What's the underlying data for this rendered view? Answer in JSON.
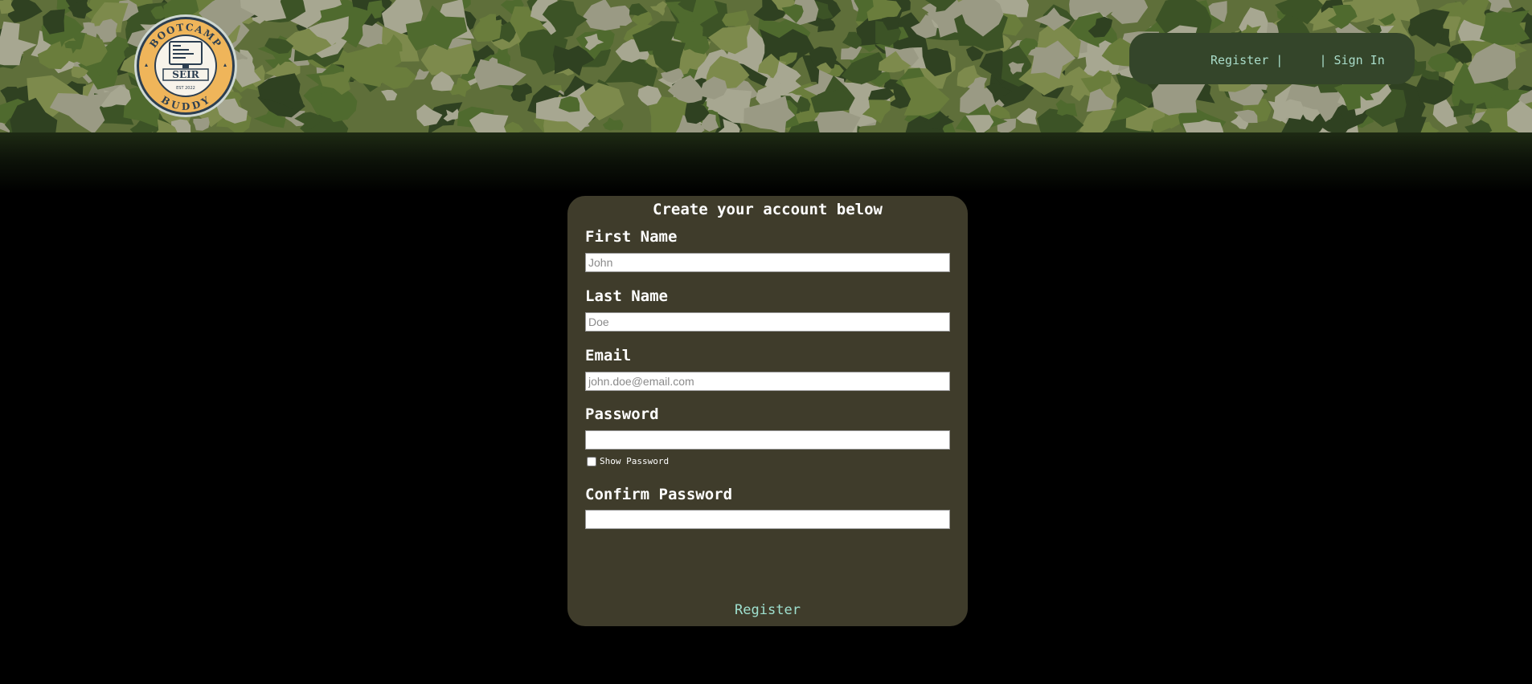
{
  "header": {
    "logo": {
      "top_text": "BOOTCAMP",
      "center_text": "SEIR",
      "est_text": "EST 2022",
      "bottom_text": "BUDDY"
    },
    "nav": {
      "register_label": "Register",
      "separator": "|",
      "sign_in_label": "Sign In"
    }
  },
  "form": {
    "title": "Create your account below",
    "first_name": {
      "label": "First Name",
      "placeholder": "John",
      "value": ""
    },
    "last_name": {
      "label": "Last Name",
      "placeholder": "Doe",
      "value": ""
    },
    "email": {
      "label": "Email",
      "placeholder": "john.doe@email.com",
      "value": ""
    },
    "password": {
      "label": "Password",
      "placeholder": "",
      "value": ""
    },
    "show_password_label": "Show Password",
    "show_password_checked": false,
    "confirm_password": {
      "label": "Confirm Password",
      "placeholder": "",
      "value": ""
    },
    "submit_label": "Register"
  },
  "colors": {
    "page_background": "#000000",
    "card_background": "#3f3c2b",
    "nav_background": "#34452a",
    "link_color": "#a9dcc9",
    "logo_gold": "#efb55a",
    "logo_navy": "#2c3e50"
  }
}
